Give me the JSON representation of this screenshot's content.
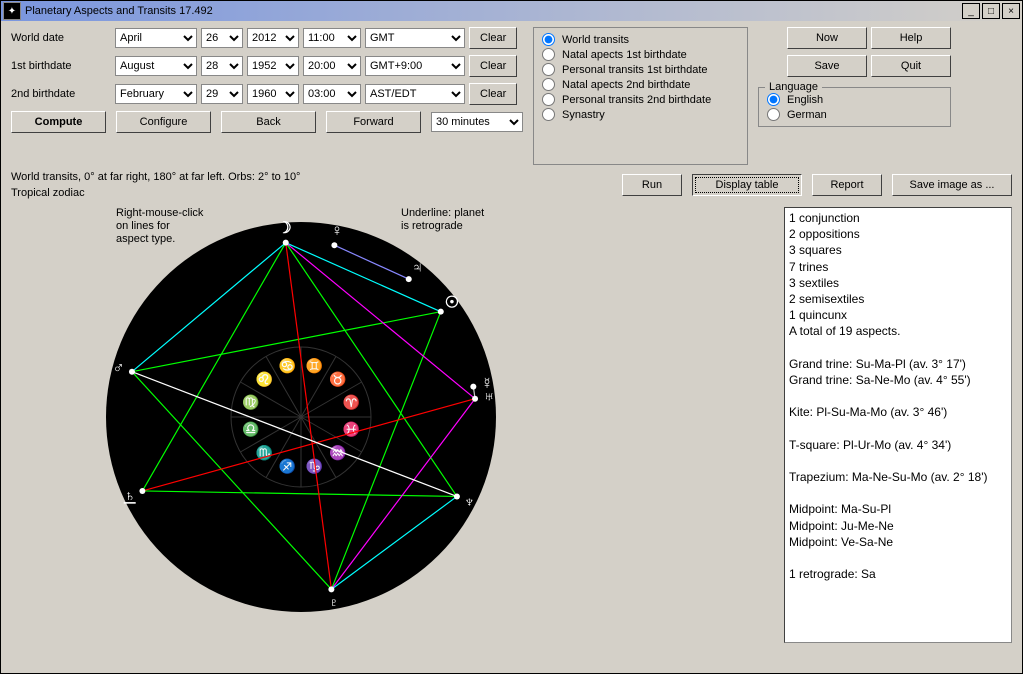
{
  "window": {
    "title": "Planetary Aspects and Transits 17.492"
  },
  "labels": {
    "world_date": "World date",
    "first_birthdate": "1st birthdate",
    "second_birthdate": "2nd birthdate"
  },
  "world_date": {
    "month": "April",
    "day": "26",
    "year": "2012",
    "time": "11:00",
    "tz": "GMT"
  },
  "first_birthdate": {
    "month": "August",
    "day": "28",
    "year": "1952",
    "time": "20:00",
    "tz": "GMT+9:00"
  },
  "second_birthdate": {
    "month": "February",
    "day": "29",
    "year": "1960",
    "time": "03:00",
    "tz": "AST/EDT"
  },
  "buttons": {
    "clear": "Clear",
    "now": "Now",
    "help": "Help",
    "save": "Save",
    "quit": "Quit",
    "compute": "Compute",
    "configure": "Configure",
    "back": "Back",
    "forward": "Forward",
    "run": "Run",
    "display_table": "Display table",
    "report": "Report",
    "save_image_as": "Save image as ..."
  },
  "step": "30 minutes",
  "modes": {
    "world_transits": "World transits",
    "natal_1st": "Natal apects 1st birthdate",
    "personal_1st": "Personal transits 1st birthdate",
    "natal_2nd": "Natal apects 2nd birthdate",
    "personal_2nd": "Personal transits 2nd birthdate",
    "synastry": "Synastry"
  },
  "language": {
    "label": "Language",
    "english": "English",
    "german": "German"
  },
  "info": {
    "line1": "World transits, 0° at far right, 180° at far left.  Orbs: 2° to 10°",
    "line2": "Tropical zodiac"
  },
  "hints": {
    "left": "Right-mouse-click\non lines for\naspect type.",
    "right": "Underline: planet\nis retrograde"
  },
  "results_text": "1 conjunction\n2 oppositions\n3 squares\n7 trines\n3 sextiles\n2 semisextiles\n1 quincunx\nA total of 19 aspects.\n\nGrand trine: Su-Ma-Pl (av. 3° 17')\nGrand trine: Sa-Ne-Mo (av. 4° 55')\n\nKite: Pl-Su-Ma-Mo (av. 3° 46')\n\nT-square: Pl-Ur-Mo (av. 4° 34')\n\nTrapezium: Ma-Ne-Su-Mo (av. 2° 18')\n\nMidpoint: Ma-Su-Pl\nMidpoint: Ju-Me-Ne\nMidpoint: Ve-Sa-Ne\n\n1 retrograde: Sa",
  "chart_data": {
    "type": "aspect-wheel",
    "zodiac": "tropical",
    "zero_at": "far right",
    "orbs_deg": [
      2,
      10
    ],
    "planets": [
      {
        "name": "Sun",
        "sym": "☉",
        "deg": 37
      },
      {
        "name": "Mercury",
        "sym": "☿",
        "deg": 10
      },
      {
        "name": "Uranus",
        "sym": "♅",
        "deg": 6
      },
      {
        "name": "Jupiter",
        "sym": "♃",
        "deg": 52
      },
      {
        "name": "Venus",
        "sym": "♀",
        "deg": 79
      },
      {
        "name": "Moon",
        "sym": "☽",
        "deg": 95
      },
      {
        "name": "Mars",
        "sym": "♂",
        "deg": 165
      },
      {
        "name": "Saturn",
        "sym": "♄",
        "deg": 205,
        "retro": true
      },
      {
        "name": "Pluto",
        "sym": "♇",
        "deg": 280
      },
      {
        "name": "Neptune",
        "sym": "♆",
        "deg": 333
      }
    ],
    "aspects": [
      {
        "a": "Sun",
        "b": "Mars",
        "type": "trine",
        "color": "#00ff00"
      },
      {
        "a": "Sun",
        "b": "Pluto",
        "type": "trine",
        "color": "#00ff00"
      },
      {
        "a": "Mars",
        "b": "Pluto",
        "type": "trine",
        "color": "#00ff00"
      },
      {
        "a": "Saturn",
        "b": "Neptune",
        "type": "trine",
        "color": "#00ff00"
      },
      {
        "a": "Saturn",
        "b": "Moon",
        "type": "trine",
        "color": "#00ff00"
      },
      {
        "a": "Neptune",
        "b": "Moon",
        "type": "trine",
        "color": "#00ff00"
      },
      {
        "a": "Sun",
        "b": "Moon",
        "type": "sextile",
        "color": "#00ffff"
      },
      {
        "a": "Mars",
        "b": "Moon",
        "type": "sextile",
        "color": "#00ffff"
      },
      {
        "a": "Pluto",
        "b": "Neptune",
        "type": "sextile",
        "color": "#00ffff"
      },
      {
        "a": "Moon",
        "b": "Pluto",
        "type": "opposition",
        "color": "#ff0000"
      },
      {
        "a": "Uranus",
        "b": "Saturn",
        "type": "opposition",
        "color": "#ff0000"
      },
      {
        "a": "Pluto",
        "b": "Uranus",
        "type": "square",
        "color": "#ff00ff"
      },
      {
        "a": "Moon",
        "b": "Uranus",
        "type": "square",
        "color": "#ff00ff"
      },
      {
        "a": "Mars",
        "b": "Neptune",
        "type": "quincunx",
        "color": "#ffffff"
      },
      {
        "a": "Venus",
        "b": "Jupiter",
        "type": "semisextile",
        "color": "#8888ff"
      },
      {
        "a": "Mercury",
        "b": "Uranus",
        "type": "conjunction",
        "color": "#cccccc"
      }
    ]
  }
}
